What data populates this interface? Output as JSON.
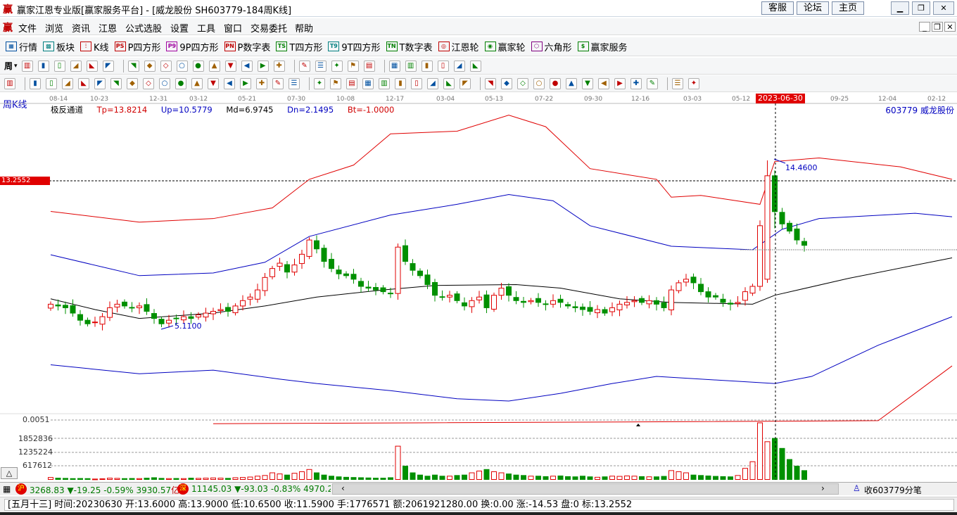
{
  "window": {
    "title": "赢家江恩专业版[赢家服务平台] - [威龙股份  SH603779-184周K线]",
    "logo": "赢",
    "buttons": [
      "客服",
      "论坛",
      "主页"
    ],
    "controls": [
      "minimize",
      "restore",
      "close"
    ]
  },
  "menu": {
    "logo": "赢",
    "items": [
      "文件",
      "浏览",
      "资讯",
      "江恩",
      "公式选股",
      "设置",
      "工具",
      "窗口",
      "交易委托",
      "帮助"
    ]
  },
  "toolbar1": [
    {
      "icon": "quote-table-icon",
      "g": "▦",
      "label": "行情"
    },
    {
      "icon": "sector-icon",
      "g": "▩",
      "label": "板块"
    },
    {
      "icon": "kline-icon",
      "g": "⫶",
      "label": "K线"
    },
    {
      "icon": "ps-icon",
      "g": "PS",
      "label": "P四方形"
    },
    {
      "icon": "p9-icon",
      "g": "P9",
      "label": "9P四方形"
    },
    {
      "icon": "pn-icon",
      "g": "PN",
      "label": "P数字表"
    },
    {
      "icon": "ts-icon",
      "g": "TS",
      "label": "T四方形"
    },
    {
      "icon": "t9-icon",
      "g": "T9",
      "label": "9T四方形"
    },
    {
      "icon": "tn-icon",
      "g": "TN",
      "label": "T数字表"
    },
    {
      "icon": "gann-wheel-icon",
      "g": "◎",
      "label": "江恩轮"
    },
    {
      "icon": "winner-wheel-icon",
      "g": "◉",
      "label": "赢家轮"
    },
    {
      "icon": "hexagon-icon",
      "g": "⬡",
      "label": "六角形"
    },
    {
      "icon": "dollar-icon",
      "g": "$",
      "label": "赢家服务"
    }
  ],
  "toolbar2": {
    "period": "周",
    "icons": [
      "bar-chart-icon",
      "candle-icon",
      "ohlc-icon",
      "line-icon",
      "rank-icon",
      "gann-icon",
      "flag-icon",
      "first-icon",
      "last-icon",
      "prev-icon",
      "next-icon",
      "diamond-1-icon",
      "diamond-2-icon",
      "diamond-3-icon",
      "diamond-4-icon",
      "diamond-5-icon",
      "hand-icon",
      "crosshair-icon",
      "zigzag-icon",
      "formula-icon",
      "paint-icon",
      "calendar-icon",
      "calculator-icon",
      "notes-icon",
      "save-icon",
      "print-icon",
      "bus-icon"
    ]
  },
  "toolbar3": {
    "icons": [
      "pen-icon",
      "draw-1-icon",
      "draw-2-icon",
      "draw-3-icon",
      "draw-4-icon",
      "draw-5-icon",
      "circle-icon",
      "draw-6-icon",
      "draw-7-icon",
      "draw-8-icon",
      "draw-9-icon",
      "draw-10-icon",
      "draw-11-icon",
      "draw-12-icon",
      "draw-13-icon",
      "draw-14-icon",
      "draw-15-icon",
      "draw-16-icon",
      "draw-17-icon",
      "draw-18-icon",
      "draw-19-icon",
      "draw-20-icon",
      "draw-21-icon",
      "draw-22-icon",
      "draw-23-icon",
      "draw-24-icon",
      "draw-25-icon",
      "draw-26-icon",
      "percent-icon",
      "draw-27-icon",
      "draw-28-icon",
      "draw-29-icon",
      "draw-30-icon",
      "draw-31-icon",
      "draw-32-icon",
      "draw-33-icon",
      "draw-34-icon",
      "draw-35-icon",
      "draw-36-icon",
      "yinyang-icon",
      "infinity-icon"
    ]
  },
  "chart": {
    "period_label": "周K线",
    "date_ticks": [
      "08-14",
      "10-23",
      "12-31",
      "03-12",
      "05-21",
      "07-30",
      "10-08",
      "12-17",
      "03-04",
      "05-13",
      "07-22",
      "09-30",
      "12-16",
      "03-03",
      "05-12",
      "09-25",
      "12-04",
      "02-12"
    ],
    "cursor_date": "2023-06-30",
    "indicator": {
      "name": "极反通道",
      "tp": "Tp=13.8214",
      "up": "Up=10.5779",
      "md": "Md=6.9745",
      "dn": "Dn=2.1495",
      "bt": "Bt=-1.0000"
    },
    "stock": "603779  威龙股份",
    "cursor_price": "13.2552",
    "high_mark": "14.4600",
    "low_mark": "5.1100",
    "sub_label": "0.0051",
    "volume_ticks": [
      "1852836",
      "1235224",
      "617612"
    ],
    "colors": {
      "up": "#e00000",
      "down": "#009000",
      "upper_red": "#e00000",
      "blue": "#0000c0",
      "mid": "#000000"
    }
  },
  "chart_data": {
    "type": "candlestick",
    "price_unit": "CNY",
    "closes": [
      6.4,
      6.3,
      6.2,
      5.9,
      5.5,
      5.3,
      5.4,
      5.7,
      6.2,
      6.4,
      6.3,
      6.2,
      6.3,
      6.0,
      5.6,
      5.3,
      5.5,
      5.6,
      5.7,
      5.6,
      5.8,
      5.9,
      6.0,
      6.1,
      6.0,
      6.3,
      6.6,
      6.8,
      7.2,
      7.9,
      8.4,
      8.7,
      8.2,
      8.6,
      9.2,
      10.0,
      9.5,
      8.8,
      8.4,
      8.1,
      8.0,
      7.8,
      7.4,
      7.3,
      7.2,
      7.1,
      7.0,
      9.6,
      8.8,
      8.3,
      8.0,
      7.5,
      6.9,
      6.8,
      6.9,
      6.6,
      6.3,
      6.6,
      6.8,
      6.2,
      6.9,
      7.3,
      6.9,
      6.6,
      6.5,
      6.6,
      6.5,
      6.4,
      6.6,
      6.5,
      6.3,
      6.2,
      6.1,
      6.0,
      6.1,
      5.9,
      6.2,
      6.4,
      6.5,
      6.6,
      6.5,
      6.6,
      6.4,
      6.2,
      7.2,
      7.6,
      7.8,
      7.6,
      7.1,
      6.8,
      6.8,
      6.5,
      6.4,
      6.5,
      7.1,
      7.4,
      10.8,
      13.6,
      11.59,
      10.9,
      10.5,
      10.0,
      9.7
    ],
    "volumes": [
      90,
      60,
      50,
      40,
      45,
      40,
      20,
      30,
      60,
      50,
      40,
      45,
      40,
      60,
      80,
      50,
      40,
      45,
      40,
      60,
      50,
      60,
      70,
      60,
      50,
      80,
      90,
      110,
      150,
      180,
      300,
      250,
      200,
      280,
      350,
      450,
      300,
      200,
      150,
      120,
      100,
      90,
      80,
      70,
      60,
      60,
      80,
      1500,
      600,
      300,
      200,
      150,
      200,
      150,
      150,
      180,
      200,
      300,
      380,
      450,
      350,
      300,
      250,
      200,
      180,
      150,
      150,
      130,
      150,
      160,
      130,
      120,
      150,
      120,
      100,
      120,
      150,
      140,
      160,
      150,
      130,
      120,
      120,
      140,
      400,
      350,
      300,
      200,
      180,
      160,
      140,
      130,
      120,
      180,
      500,
      800,
      2550,
      1700,
      1850,
      1400,
      900,
      600,
      400
    ],
    "volume_unit": "lots (approx, thousands)",
    "bands": {
      "upper_red": [
        [
          0,
          11.6
        ],
        [
          12,
          11.0
        ],
        [
          22,
          11.2
        ],
        [
          30,
          11.8
        ],
        [
          35,
          13.4
        ],
        [
          41,
          14.2
        ],
        [
          46,
          15.95
        ],
        [
          55,
          16.1
        ],
        [
          62,
          17.0
        ],
        [
          67,
          16.35
        ],
        [
          73,
          14.0
        ],
        [
          82,
          13.4
        ],
        [
          84,
          12.4
        ],
        [
          88,
          12.5
        ],
        [
          96,
          12.0
        ],
        [
          98,
          14.4
        ],
        [
          104,
          14.6
        ],
        [
          115,
          14.1
        ],
        [
          122,
          13.4
        ]
      ],
      "upper_blue": [
        [
          0,
          9.17
        ],
        [
          12,
          8.0
        ],
        [
          22,
          8.15
        ],
        [
          29,
          8.75
        ],
        [
          35,
          10.2
        ],
        [
          46,
          11.4
        ],
        [
          55,
          12.0
        ],
        [
          62,
          12.55
        ],
        [
          68,
          12.2
        ],
        [
          73,
          10.8
        ],
        [
          84,
          9.65
        ],
        [
          95,
          9.45
        ],
        [
          99,
          10.6
        ],
        [
          104,
          11.2
        ],
        [
          117,
          11.5
        ],
        [
          122,
          11.3
        ]
      ],
      "middle": [
        [
          0,
          6.7
        ],
        [
          6,
          6.1
        ],
        [
          12,
          5.6
        ],
        [
          22,
          5.9
        ],
        [
          29,
          6.3
        ],
        [
          36,
          6.8
        ],
        [
          45,
          7.2
        ],
        [
          52,
          7.45
        ],
        [
          63,
          7.5
        ],
        [
          69,
          7.3
        ],
        [
          77,
          6.7
        ],
        [
          84,
          6.5
        ],
        [
          95,
          6.4
        ],
        [
          98,
          6.9
        ],
        [
          108,
          7.85
        ],
        [
          122,
          9.0
        ]
      ],
      "lower_blue": [
        [
          0,
          3.0
        ],
        [
          12,
          2.5
        ],
        [
          22,
          2.7
        ],
        [
          31,
          2.2
        ],
        [
          36,
          1.95
        ],
        [
          46,
          1.55
        ],
        [
          55,
          1.1
        ],
        [
          62,
          0.97
        ],
        [
          69,
          1.4
        ],
        [
          76,
          1.95
        ],
        [
          82,
          2.35
        ],
        [
          98,
          1.95
        ],
        [
          103,
          2.35
        ],
        [
          112,
          4.1
        ],
        [
          122,
          5.7
        ]
      ],
      "lower_red": [
        [
          22,
          -0.3
        ],
        [
          50,
          -0.25
        ],
        [
          80,
          -0.2
        ],
        [
          112,
          -0.13
        ],
        [
          122,
          2.94
        ]
      ]
    },
    "selected": {
      "date": "20230630",
      "open": 13.6,
      "high": 13.9,
      "low": 10.65,
      "close": 11.59
    }
  },
  "status1": {
    "sh_icon": "沪",
    "sh": "3268.83",
    "sh_chg": "▼-19.25",
    "sh_pct": "-0.59%",
    "sh_amt": "3930.57",
    "sh_unit": "亿",
    "sz_icon": "深",
    "sz": "11145.03",
    "sz_chg": "▼-93.03",
    "sz_pct": "-0.83%",
    "sz_amt": "4970.20",
    "right": "收603779分笔"
  },
  "status2": {
    "text": "[五月十三] 时间:20230630 开:13.6000 高:13.9000 低:10.6500 收:11.5900 手:1776571 额:2061921280.00 换:0.00 涨:-14.53 盘:0 标:13.2552"
  }
}
